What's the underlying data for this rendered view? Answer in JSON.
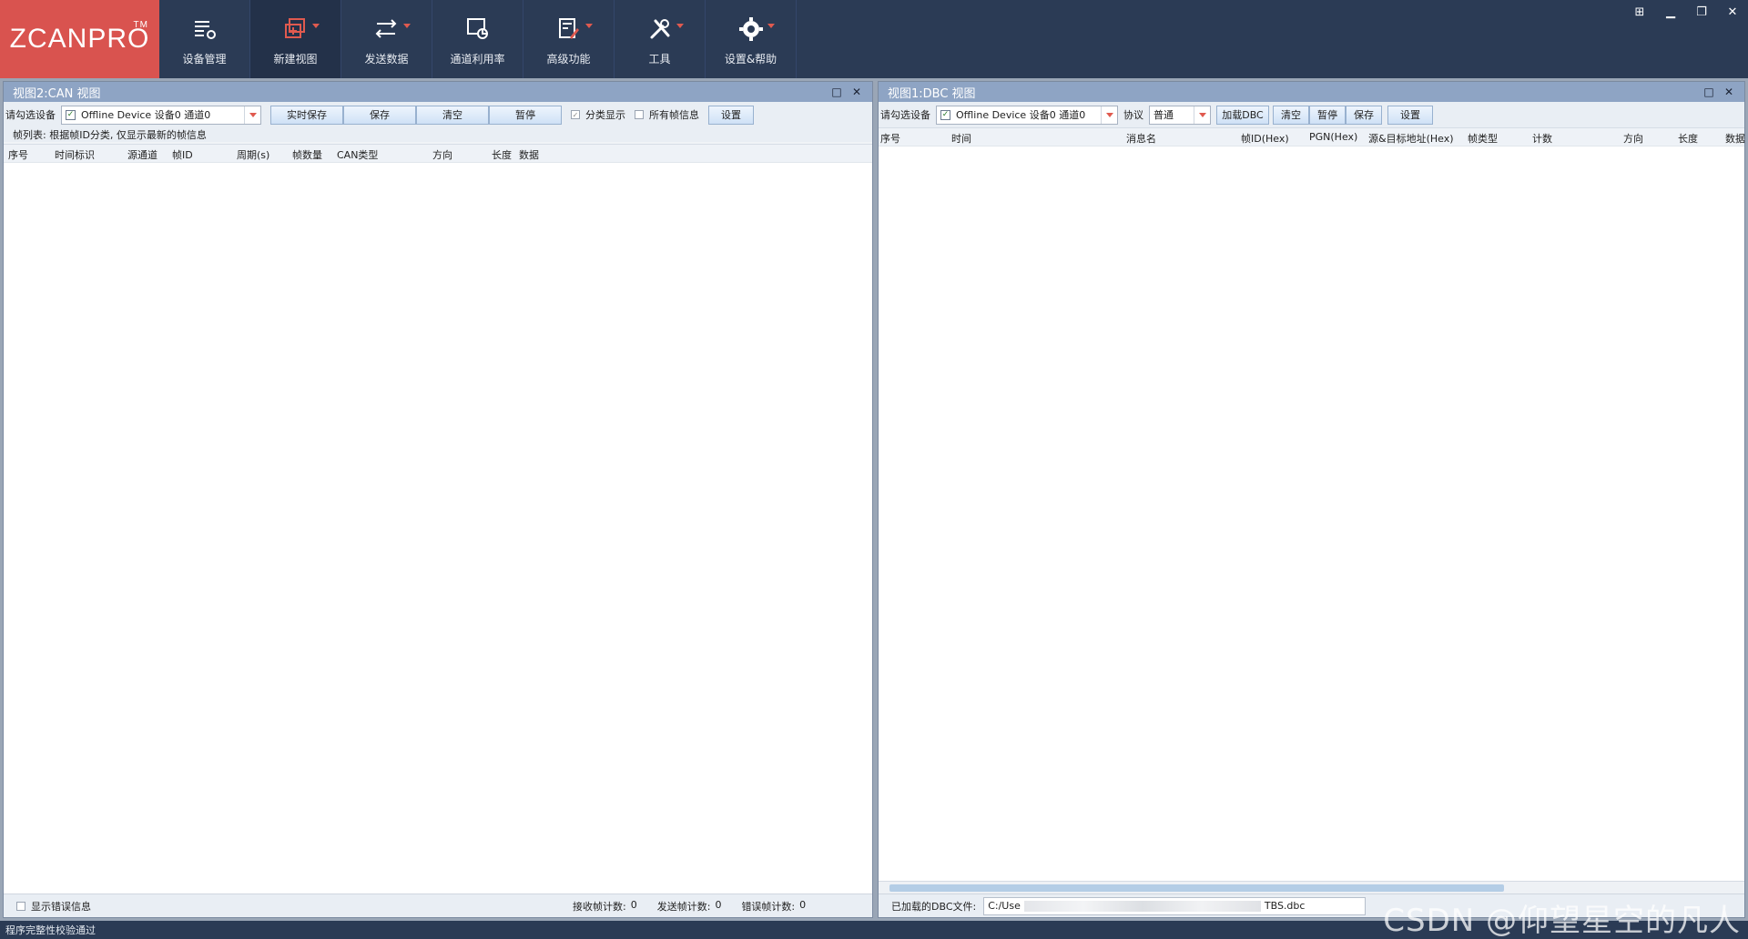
{
  "app": {
    "logo": "ZCANPRO",
    "logo_tm": "TM"
  },
  "ribbon": [
    {
      "label": "设备管理",
      "icon": "device-manage-icon",
      "dropdown": false
    },
    {
      "label": "新建视图",
      "icon": "new-view-icon",
      "dropdown": true
    },
    {
      "label": "发送数据",
      "icon": "send-data-icon",
      "dropdown": true
    },
    {
      "label": "通道利用率",
      "icon": "channel-usage-icon",
      "dropdown": false
    },
    {
      "label": "高级功能",
      "icon": "advanced-icon",
      "dropdown": true
    },
    {
      "label": "工具",
      "icon": "tools-icon",
      "dropdown": true
    },
    {
      "label": "设置&帮助",
      "icon": "gear-icon",
      "dropdown": true
    }
  ],
  "left_panel": {
    "title": "视图2:CAN 视图",
    "device_label": "请勾选设备",
    "device_value": "Offline Device 设备0 通道0",
    "buttons": {
      "realtime_save": "实时保存",
      "save": "保存",
      "clear": "清空",
      "pause": "暂停",
      "settings": "设置"
    },
    "classify_label": "分类显示",
    "all_frames_label": "所有帧信息",
    "note": "帧列表: 根据帧ID分类, 仅显示最新的帧信息",
    "columns": [
      "序号",
      "时间标识",
      "源通道",
      "帧ID",
      "周期(s)",
      "帧数量",
      "CAN类型",
      "方向",
      "长度",
      "数据"
    ],
    "footer": {
      "show_errors": "显示错误信息",
      "rx_label": "接收帧计数:",
      "rx_value": "0",
      "tx_label": "发送帧计数:",
      "tx_value": "0",
      "err_label": "错误帧计数:",
      "err_value": "0"
    }
  },
  "right_panel": {
    "title": "视图1:DBC 视图",
    "device_label": "请勾选设备",
    "device_value": "Offline Device 设备0 通道0",
    "protocol_label": "协议",
    "protocol_value": "普通",
    "buttons": {
      "load_dbc": "加载DBC",
      "clear": "清空",
      "pause": "暂停",
      "save": "保存",
      "settings": "设置"
    },
    "columns": [
      "序号",
      "时间",
      "消息名",
      "帧ID(Hex)",
      "PGN(Hex)",
      "源&目标地址(Hex)",
      "帧类型",
      "计数",
      "方向",
      "长度",
      "数据"
    ],
    "footer": {
      "loaded_label": "已加载的DBC文件:",
      "file_prefix": "C:/Use",
      "file_suffix": "TBS.dbc"
    }
  },
  "status": "程序完整性校验通过",
  "watermark": "CSDN @仰望星空的凡人"
}
